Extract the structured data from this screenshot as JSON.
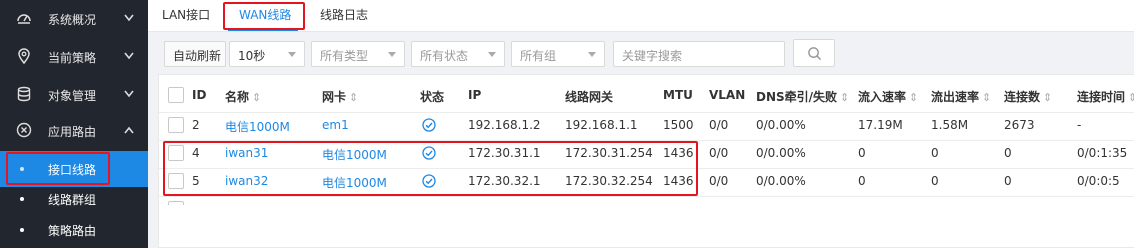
{
  "sidebar": {
    "items": [
      {
        "label": "系统概况",
        "icon": "dashboard-icon"
      },
      {
        "label": "当前策略",
        "icon": "location-pin-icon"
      },
      {
        "label": "对象管理",
        "icon": "database-icon"
      },
      {
        "label": "应用路由",
        "icon": "route-icon"
      }
    ],
    "sub_items": [
      {
        "label": "接口线路",
        "active": true
      },
      {
        "label": "线路群组",
        "active": false
      },
      {
        "label": "策略路由",
        "active": false
      }
    ]
  },
  "tabs": [
    {
      "label": "LAN接口",
      "active": false
    },
    {
      "label": "WAN线路",
      "active": true
    },
    {
      "label": "线路日志",
      "active": false
    }
  ],
  "toolbar": {
    "auto_refresh_label": "自动刷新",
    "interval_value": "10秒",
    "type_filter": "所有类型",
    "status_filter": "所有状态",
    "group_filter": "所有组",
    "search_placeholder": "关键字搜索"
  },
  "table": {
    "headers": {
      "id": "ID",
      "name": "名称",
      "nic": "网卡",
      "status": "状态",
      "ip": "IP",
      "gateway": "线路网关",
      "mtu": "MTU",
      "vlan": "VLAN",
      "dns": "DNS牵引/失败",
      "in_rate": "流入速率",
      "out_rate": "流出速率",
      "conns": "连接数",
      "conn_time": "连接时间"
    },
    "rows": [
      {
        "id": "2",
        "name": "电信1000M",
        "nic": "em1",
        "ip": "192.168.1.2",
        "gateway": "192.168.1.1",
        "mtu": "1500",
        "vlan": "0/0",
        "dns": "0/0.00%",
        "in_rate": "17.19M",
        "out_rate": "1.58M",
        "conns": "2673",
        "conn_time": "-"
      },
      {
        "id": "4",
        "name": "iwan31",
        "nic": "电信1000M",
        "ip": "172.30.31.1",
        "gateway": "172.30.31.254",
        "mtu": "1436",
        "vlan": "0/0",
        "dns": "0/0.00%",
        "in_rate": "0",
        "out_rate": "0",
        "conns": "0",
        "conn_time": "0/0:1:35"
      },
      {
        "id": "5",
        "name": "iwan32",
        "nic": "电信1000M",
        "ip": "172.30.32.1",
        "gateway": "172.30.32.254",
        "mtu": "1436",
        "vlan": "0/0",
        "dns": "0/0.00%",
        "in_rate": "0",
        "out_rate": "0",
        "conns": "0",
        "conn_time": "0/0:0:5"
      }
    ]
  },
  "colors": {
    "accent": "#1e88e5",
    "highlight": "#e4151f",
    "sidebar_bg": "#22262e"
  }
}
